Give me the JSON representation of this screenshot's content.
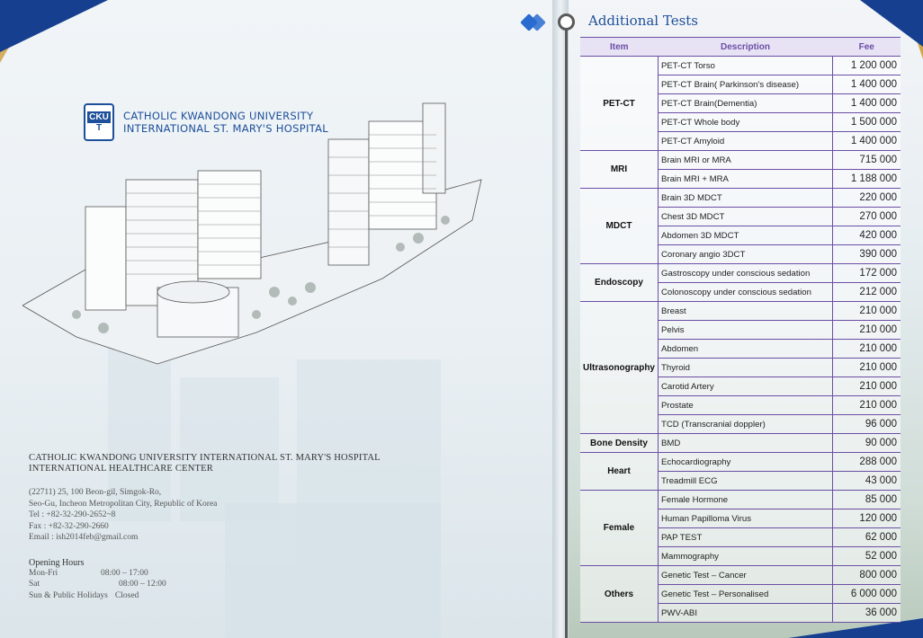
{
  "left": {
    "logo": {
      "mark_top": "CKU",
      "mark_bottom": "T",
      "line1": "CATHOLIC KWANDONG UNIVERSITY",
      "line2": "INTERNATIONAL ST. MARY'S HOSPITAL"
    },
    "center": {
      "name_line1": "CATHOLIC KWANDONG UNIVERSITY INTERNATIONAL ST. MARY'S HOSPITAL",
      "name_line2": "INTERNATIONAL HEALTHCARE CENTER",
      "address1": "(22711) 25, 100 Beon-gil, Simgok-Ro,",
      "address2": "Seo-Gu, Incheon Metropolitan City, Republic of Korea",
      "tel": "Tel : +82-32-290-2652~8",
      "fax": "Fax : +82-32-290-2660",
      "email": "Email : ish2014feb@gmail.com"
    },
    "hours": {
      "heading": "Opening Hours",
      "rows": [
        {
          "day": "Mon-Fri",
          "time": "08:00 – 17:00"
        },
        {
          "day": "Sat",
          "time": "08:00 – 12:00"
        },
        {
          "day": "Sun & Public Holidays",
          "time": "Closed"
        }
      ]
    }
  },
  "right": {
    "title": "Additional Tests",
    "table": {
      "headers": {
        "item": "Item",
        "description": "Description",
        "fee": "Fee"
      },
      "groups": [
        {
          "item": "PET-CT",
          "rows": [
            {
              "desc": "PET-CT Torso",
              "fee": "1 200 000"
            },
            {
              "desc": "PET-CT Brain( Parkinson's disease)",
              "fee": "1 400 000"
            },
            {
              "desc": "PET-CT Brain(Dementia)",
              "fee": "1 400 000"
            },
            {
              "desc": "PET-CT Whole body",
              "fee": "1 500 000"
            },
            {
              "desc": "PET-CT Amyloid",
              "fee": "1 400 000"
            }
          ]
        },
        {
          "item": "MRI",
          "rows": [
            {
              "desc": "Brain MRI or  MRA",
              "fee": "715 000"
            },
            {
              "desc": "Brain MRI + MRA",
              "fee": "1 188 000"
            }
          ]
        },
        {
          "item": "MDCT",
          "rows": [
            {
              "desc": "Brain 3D MDCT",
              "fee": "220 000"
            },
            {
              "desc": "Chest 3D MDCT",
              "fee": "270 000"
            },
            {
              "desc": "Abdomen 3D MDCT",
              "fee": "420 000"
            },
            {
              "desc": "Coronary angio 3DCT",
              "fee": "390 000"
            }
          ]
        },
        {
          "item": "Endoscopy",
          "rows": [
            {
              "desc": "Gastroscopy under conscious sedation",
              "fee": "172 000"
            },
            {
              "desc": "Colonoscopy under conscious sedation",
              "fee": "212 000"
            }
          ]
        },
        {
          "item": "Ultrasonography",
          "rows": [
            {
              "desc": "Breast",
              "fee": "210 000"
            },
            {
              "desc": "Pelvis",
              "fee": "210 000"
            },
            {
              "desc": "Abdomen",
              "fee": "210 000"
            },
            {
              "desc": "Thyroid",
              "fee": "210 000"
            },
            {
              "desc": "Carotid Artery",
              "fee": "210 000"
            },
            {
              "desc": "Prostate",
              "fee": "210 000"
            },
            {
              "desc": "TCD (Transcranial doppler)",
              "fee": "96 000"
            }
          ]
        },
        {
          "item": "Bone Density",
          "rows": [
            {
              "desc": "BMD",
              "fee": "90 000"
            }
          ]
        },
        {
          "item": "Heart",
          "rows": [
            {
              "desc": "Echocardiography",
              "fee": "288 000"
            },
            {
              "desc": "Treadmill ECG",
              "fee": "43 000"
            }
          ]
        },
        {
          "item": "Female",
          "rows": [
            {
              "desc": "Female Hormone",
              "fee": "85 000"
            },
            {
              "desc": "Human Papilloma Virus",
              "fee": "120 000"
            },
            {
              "desc": "PAP TEST",
              "fee": "62 000"
            },
            {
              "desc": "Mammography",
              "fee": "52 000"
            }
          ]
        },
        {
          "item": "Others",
          "rows": [
            {
              "desc": "Genetic Test – Cancer",
              "fee": "800 000"
            },
            {
              "desc": "Genetic Test – Personalised",
              "fee": "6 000 000"
            },
            {
              "desc": "PWV-ABI",
              "fee": "36 000"
            }
          ]
        }
      ]
    }
  }
}
